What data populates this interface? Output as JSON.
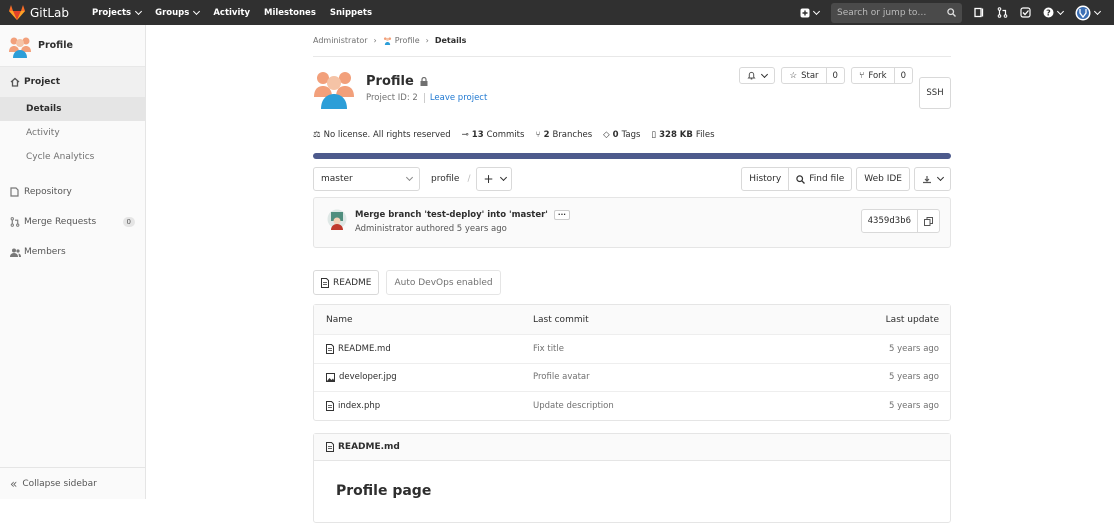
{
  "topbar": {
    "brand": "GitLab",
    "nav": [
      "Projects",
      "Groups",
      "Activity",
      "Milestones",
      "Snippets"
    ],
    "search_placeholder": "Search or jump to…"
  },
  "sidebar": {
    "project_name": "Profile",
    "section": "Project",
    "sub_items": [
      "Details",
      "Activity",
      "Cycle Analytics"
    ],
    "items": [
      "Repository",
      "Merge Requests",
      "Members"
    ],
    "merge_requests_count": "0",
    "collapse": "Collapse sidebar"
  },
  "breadcrumb": {
    "owner": "Administrator",
    "project": "Profile",
    "current": "Details"
  },
  "project": {
    "title": "Profile",
    "id_text": "Project ID: 2",
    "leave": "Leave project",
    "star_label": "Star",
    "star_count": "0",
    "fork_label": "Fork",
    "fork_count": "0",
    "ssh": "SSH"
  },
  "stats": {
    "license": "No license. All rights reserved",
    "commits_n": "13",
    "commits_l": "Commits",
    "branches_n": "2",
    "branches_l": "Branches",
    "tags_n": "0",
    "tags_l": "Tags",
    "size_n": "328 KB",
    "size_l": "Files"
  },
  "toolbar": {
    "branch": "master",
    "path": "profile",
    "separator": "/",
    "history": "History",
    "find": "Find file",
    "webide": "Web IDE"
  },
  "commit": {
    "title": "Merge branch 'test-deploy' into 'master'",
    "ellipsis": "···",
    "author_line": "Administrator authored 5 years ago",
    "sha": "4359d3b6"
  },
  "pills": {
    "readme": "README",
    "devops": "Auto DevOps enabled"
  },
  "files": {
    "headers": {
      "name": "Name",
      "commit": "Last commit",
      "update": "Last update"
    },
    "rows": [
      {
        "name": "README.md",
        "commit": "Fix title",
        "update": "5 years ago",
        "icon": "file-text-icon"
      },
      {
        "name": "developer.jpg",
        "commit": "Profile avatar",
        "update": "5 years ago",
        "icon": "file-image-icon"
      },
      {
        "name": "index.php",
        "commit": "Update description",
        "update": "5 years ago",
        "icon": "file-text-icon"
      }
    ]
  },
  "readme": {
    "filename": "README.md",
    "heading": "Profile page"
  },
  "colors": {
    "topbar": "#303030",
    "lang_bar": "#4d5a8c",
    "link": "#1f78d1"
  }
}
